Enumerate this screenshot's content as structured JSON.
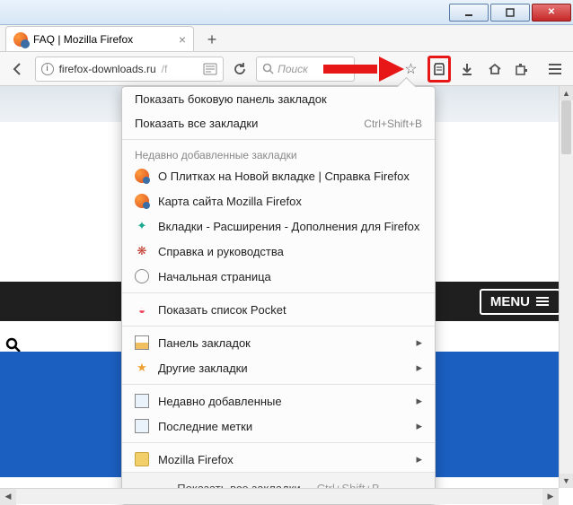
{
  "window": {
    "title": "FAQ | Mozilla Firefox"
  },
  "tab": {
    "title": "FAQ | Mozilla Firefox"
  },
  "url": {
    "domain": "firefox-downloads.ru",
    "path": "/f"
  },
  "search": {
    "placeholder": "Поиск"
  },
  "page": {
    "menu_label": "MENU"
  },
  "dropdown": {
    "show_sidebar": "Показать боковую панель закладок",
    "show_all": "Показать все закладки",
    "show_all_shortcut": "Ctrl+Shift+B",
    "recent_heading": "Недавно добавленные закладки",
    "recent": [
      "О Плитках на Новой вкладке | Справка Firefox",
      "Карта сайта Mozilla Firefox",
      "Вкладки - Расширения - Дополнения для Firefox",
      "Справка и руководства",
      "Начальная страница"
    ],
    "pocket": "Показать список Pocket",
    "panels": "Панель закладок",
    "other": "Другие закладки",
    "recently_added": "Недавно добавленные",
    "recent_tags": "Последние метки",
    "mozilla_folder": "Mozilla Firefox",
    "footer": "Показать все закладки",
    "footer_shortcut": "Ctrl+Shift+B"
  }
}
